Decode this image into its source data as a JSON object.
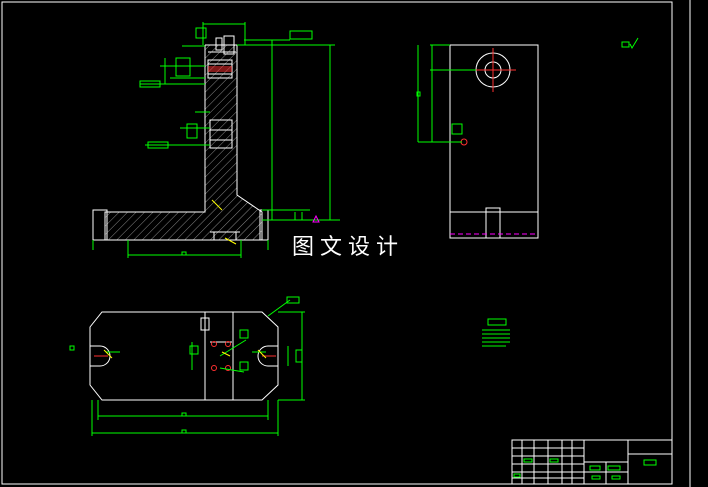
{
  "watermark_text": "图文设计",
  "colors": {
    "background": "#000000",
    "outline": "#ffffff",
    "dimension": "#00ff00",
    "hatch": "#8a8a8a",
    "center_mark": "#ff3030",
    "hidden_line": "#ff00ff",
    "leader": "#ffff00"
  }
}
